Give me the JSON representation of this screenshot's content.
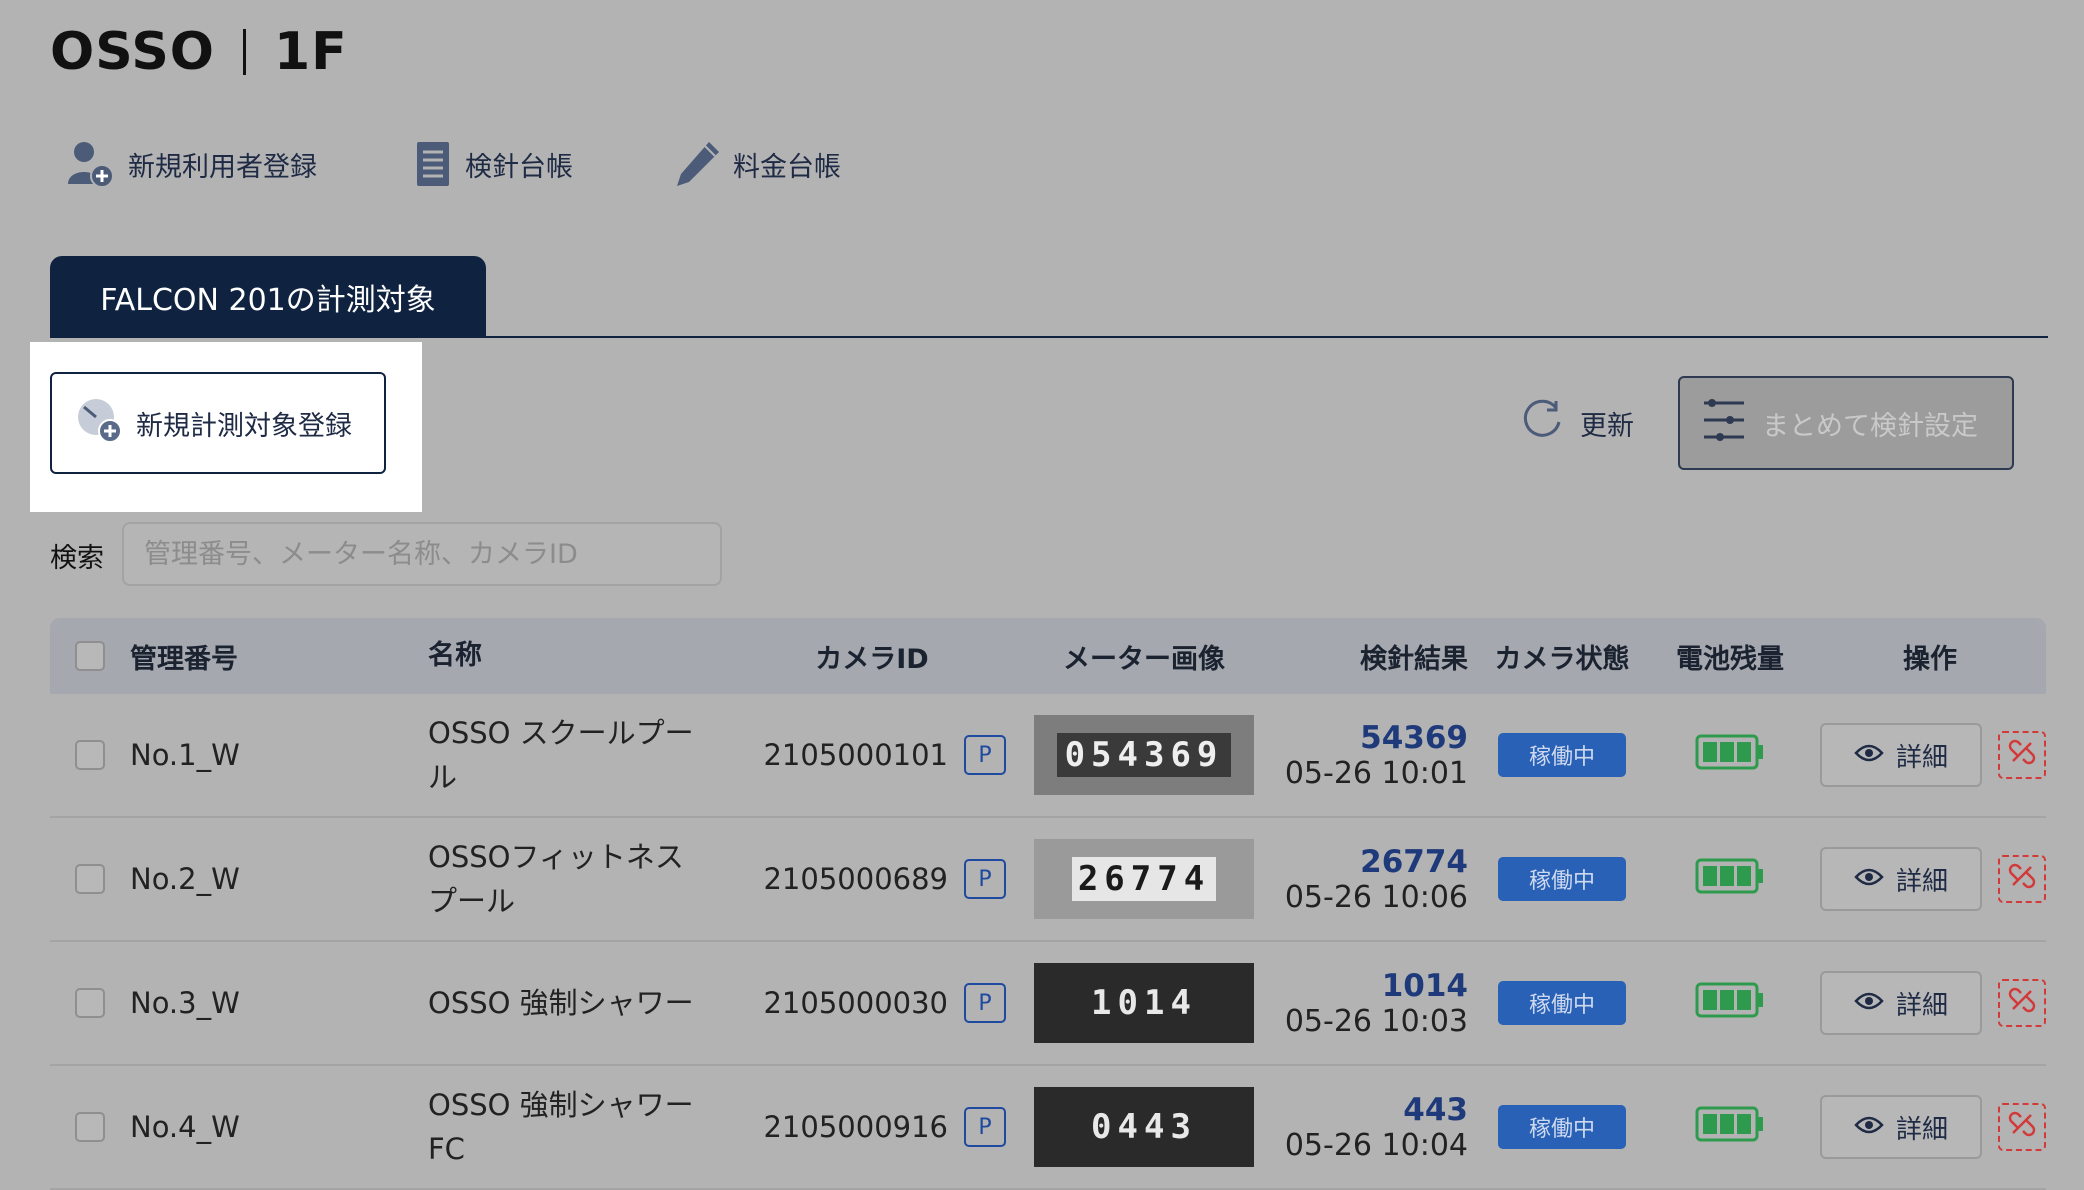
{
  "header": {
    "title_left": "OSSO",
    "title_right": "1F"
  },
  "toolbar": {
    "new_user": "新規利用者登録",
    "meter_ledger": "検針台帳",
    "fee_ledger": "料金台帳"
  },
  "tab": {
    "label": "FALCON 201の計測対象"
  },
  "actions": {
    "new_target": "新規計測対象登録",
    "refresh": "更新",
    "bulk_setting": "まとめて検針設定"
  },
  "search": {
    "label": "検索",
    "placeholder": "管理番号、メーター名称、カメラID"
  },
  "table": {
    "columns": [
      "管理番号",
      "名称",
      "カメラID",
      "メーター画像",
      "検針結果",
      "カメラ状態",
      "電池残量",
      "操作"
    ],
    "rows": [
      {
        "id": "No.1_W",
        "name_line1": "OSSO スクールプー",
        "name_line2": "ル",
        "camera_id": "2105000101",
        "p": "P",
        "meter_digits": "054369",
        "result": "54369",
        "time": "05-26 10:01",
        "state": "稼働中",
        "detail": "詳細"
      },
      {
        "id": "No.2_W",
        "name_line1": "OSSOフィットネス",
        "name_line2": "プール",
        "camera_id": "2105000689",
        "p": "P",
        "meter_digits": "26774",
        "result": "26774",
        "time": "05-26 10:06",
        "state": "稼働中",
        "detail": "詳細"
      },
      {
        "id": "No.3_W",
        "name_line1": "OSSO 強制シャワー",
        "name_line2": "",
        "camera_id": "2105000030",
        "p": "P",
        "meter_digits": "1014",
        "result": "1014",
        "time": "05-26 10:03",
        "state": "稼働中",
        "detail": "詳細"
      },
      {
        "id": "No.4_W",
        "name_line1": "OSSO 強制シャワー",
        "name_line2": "FC",
        "camera_id": "2105000916",
        "p": "P",
        "meter_digits": "0443",
        "result": "443",
        "time": "05-26 10:04",
        "state": "稼働中",
        "detail": "詳細"
      }
    ]
  },
  "colors": {
    "navy": "#0f2340",
    "status_blue": "#2861b6",
    "battery_green": "#2e9a4e",
    "danger_red": "#d23a3a"
  }
}
